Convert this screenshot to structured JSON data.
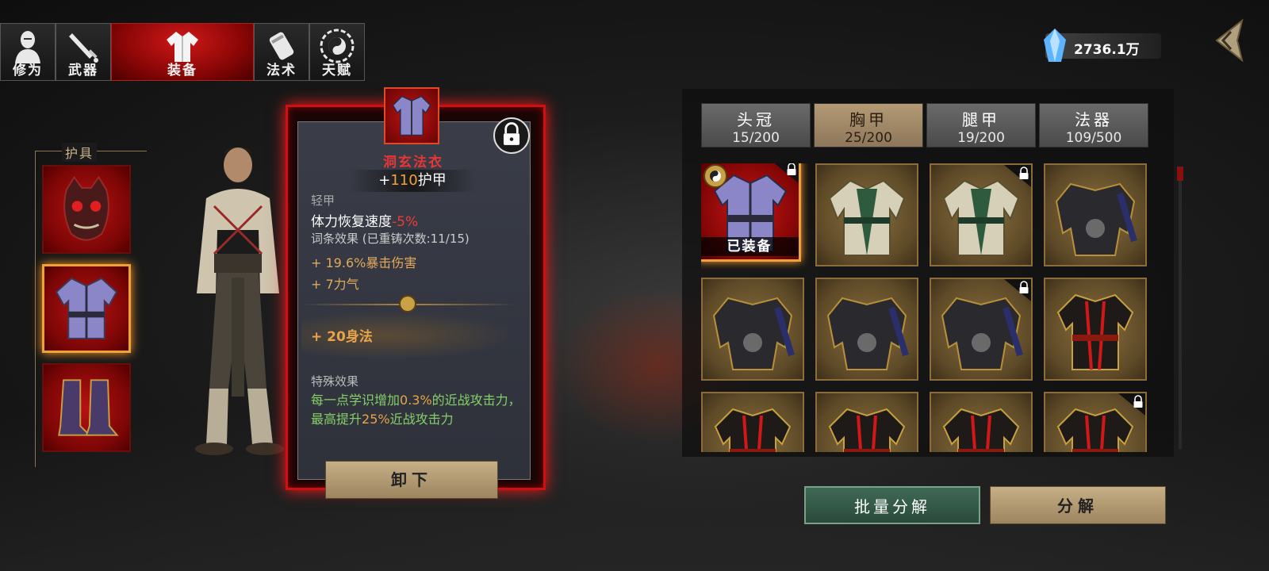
{
  "tabs": [
    {
      "label": "修为",
      "icon": "cultivation-figure-icon",
      "active": false
    },
    {
      "label": "武器",
      "icon": "sword-icon",
      "active": false
    },
    {
      "label": "装备",
      "icon": "robe-icon",
      "active": true
    },
    {
      "label": "法术",
      "icon": "scroll-icon",
      "active": false
    },
    {
      "label": "天赋",
      "icon": "bagua-icon",
      "active": false
    }
  ],
  "currency": {
    "value": "2736.1万",
    "icon": "spirit-crystal-icon"
  },
  "left_panel": {
    "section_label": "护具",
    "slots": [
      "helmet-slot",
      "chest-slot",
      "boots-slot"
    ],
    "selected": "chest-slot"
  },
  "item": {
    "name": "洞玄法衣",
    "armor_prefix": "+",
    "armor_value": "110",
    "armor_suffix": "护甲",
    "type": "轻甲",
    "stat_text": "体力恢复速度",
    "stat_value": "-5%",
    "affix_header": "词条效果  (已重铸次数:11/15)",
    "affixes": [
      "+ 19.6%暴击伤害",
      "+ 7力气"
    ],
    "bonus": "+ 20身法",
    "special_header": "特殊效果",
    "special_pre": "每一点学识增加",
    "special_hl1": "0.3%",
    "special_mid": "的近战攻击力，最高提升",
    "special_hl2": "25%",
    "special_post": "近战攻击力",
    "locked": true,
    "unequip_label": "卸下"
  },
  "categories": [
    {
      "name": "头冠",
      "count": "15/200",
      "active": false
    },
    {
      "name": "胸甲",
      "count": "25/200",
      "active": true
    },
    {
      "name": "腿甲",
      "count": "19/200",
      "active": false
    },
    {
      "name": "法器",
      "count": "109/500",
      "active": false
    }
  ],
  "inventory": [
    {
      "art": "purple-robe",
      "equipped": true,
      "locked": true,
      "equipped_label": "已装备"
    },
    {
      "art": "green-robe",
      "equipped": false,
      "locked": false
    },
    {
      "art": "green-robe",
      "equipped": false,
      "locked": true
    },
    {
      "art": "dark-armor",
      "equipped": false,
      "locked": false
    },
    {
      "art": "dark-armor",
      "equipped": false,
      "locked": false
    },
    {
      "art": "dark-armor",
      "equipped": false,
      "locked": false
    },
    {
      "art": "dark-armor",
      "equipped": false,
      "locked": true
    },
    {
      "art": "red-black-robe",
      "equipped": false,
      "locked": false
    },
    {
      "art": "red-black-robe",
      "equipped": false,
      "locked": false
    },
    {
      "art": "red-black-robe",
      "equipped": false,
      "locked": false
    },
    {
      "art": "red-black-robe",
      "equipped": false,
      "locked": false
    },
    {
      "art": "red-black-robe",
      "equipped": false,
      "locked": true
    }
  ],
  "buttons": {
    "batch_disassemble": "批量分解",
    "disassemble": "分解"
  }
}
